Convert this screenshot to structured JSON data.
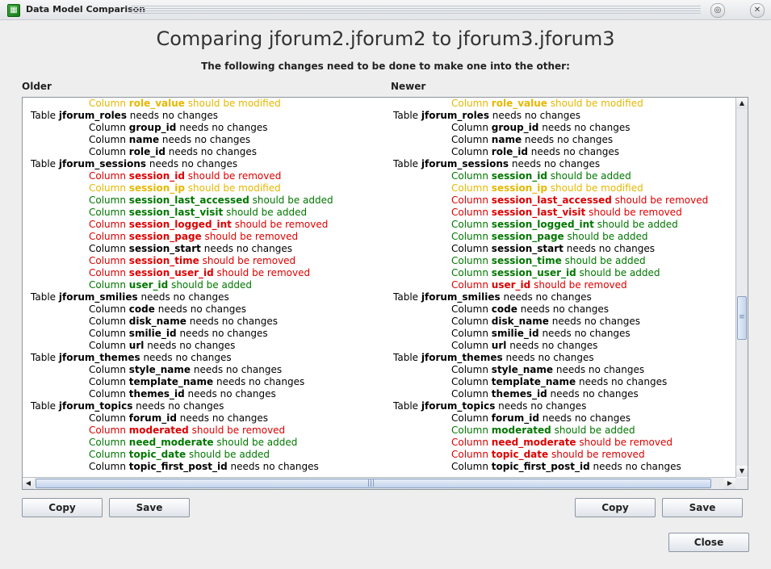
{
  "window": {
    "title": "Data Model Comparison",
    "minimize_glyph": "◎",
    "close_glyph": "✕",
    "app_icon": "table-app-icon"
  },
  "heading": "Comparing jforum2.jforum2 to jforum3.jforum3",
  "subheading": "The following changes need to be done to make one into the other:",
  "older_label": "Older",
  "newer_label": "Newer",
  "older_lines": [
    {
      "prefix": "Column",
      "name": "role_value",
      "suffix": "should be modified",
      "status": "mod",
      "indent": true
    },
    {
      "prefix": "Table",
      "name": "jforum_roles",
      "suffix": "needs no changes",
      "status": "none",
      "indent": false
    },
    {
      "prefix": "Column",
      "name": "group_id",
      "suffix": "needs no changes",
      "status": "none",
      "indent": true
    },
    {
      "prefix": "Column",
      "name": "name",
      "suffix": "needs no changes",
      "status": "none",
      "indent": true
    },
    {
      "prefix": "Column",
      "name": "role_id",
      "suffix": "needs no changes",
      "status": "none",
      "indent": true
    },
    {
      "prefix": "Table",
      "name": "jforum_sessions",
      "suffix": "needs no changes",
      "status": "none",
      "indent": false
    },
    {
      "prefix": "Column",
      "name": "session_id",
      "suffix": "should be removed",
      "status": "rem",
      "indent": true
    },
    {
      "prefix": "Column",
      "name": "session_ip",
      "suffix": "should be modified",
      "status": "mod",
      "indent": true
    },
    {
      "prefix": "Column",
      "name": "session_last_accessed",
      "suffix": "should be added",
      "status": "add",
      "indent": true
    },
    {
      "prefix": "Column",
      "name": "session_last_visit",
      "suffix": "should be added",
      "status": "add",
      "indent": true
    },
    {
      "prefix": "Column",
      "name": "session_logged_int",
      "suffix": "should be removed",
      "status": "rem",
      "indent": true
    },
    {
      "prefix": "Column",
      "name": "session_page",
      "suffix": "should be removed",
      "status": "rem",
      "indent": true
    },
    {
      "prefix": "Column",
      "name": "session_start",
      "suffix": "needs no changes",
      "status": "none",
      "indent": true
    },
    {
      "prefix": "Column",
      "name": "session_time",
      "suffix": "should be removed",
      "status": "rem",
      "indent": true
    },
    {
      "prefix": "Column",
      "name": "session_user_id",
      "suffix": "should be removed",
      "status": "rem",
      "indent": true
    },
    {
      "prefix": "Column",
      "name": "user_id",
      "suffix": "should be added",
      "status": "add",
      "indent": true
    },
    {
      "prefix": "Table",
      "name": "jforum_smilies",
      "suffix": "needs no changes",
      "status": "none",
      "indent": false
    },
    {
      "prefix": "Column",
      "name": "code",
      "suffix": "needs no changes",
      "status": "none",
      "indent": true
    },
    {
      "prefix": "Column",
      "name": "disk_name",
      "suffix": "needs no changes",
      "status": "none",
      "indent": true
    },
    {
      "prefix": "Column",
      "name": "smilie_id",
      "suffix": "needs no changes",
      "status": "none",
      "indent": true
    },
    {
      "prefix": "Column",
      "name": "url",
      "suffix": "needs no changes",
      "status": "none",
      "indent": true
    },
    {
      "prefix": "Table",
      "name": "jforum_themes",
      "suffix": "needs no changes",
      "status": "none",
      "indent": false
    },
    {
      "prefix": "Column",
      "name": "style_name",
      "suffix": "needs no changes",
      "status": "none",
      "indent": true
    },
    {
      "prefix": "Column",
      "name": "template_name",
      "suffix": "needs no changes",
      "status": "none",
      "indent": true
    },
    {
      "prefix": "Column",
      "name": "themes_id",
      "suffix": "needs no changes",
      "status": "none",
      "indent": true
    },
    {
      "prefix": "Table",
      "name": "jforum_topics",
      "suffix": "needs no changes",
      "status": "none",
      "indent": false
    },
    {
      "prefix": "Column",
      "name": "forum_id",
      "suffix": "needs no changes",
      "status": "none",
      "indent": true
    },
    {
      "prefix": "Column",
      "name": "moderated",
      "suffix": "should be removed",
      "status": "rem",
      "indent": true
    },
    {
      "prefix": "Column",
      "name": "need_moderate",
      "suffix": "should be added",
      "status": "add",
      "indent": true
    },
    {
      "prefix": "Column",
      "name": "topic_date",
      "suffix": "should be added",
      "status": "add",
      "indent": true
    },
    {
      "prefix": "Column",
      "name": "topic_first_post_id",
      "suffix": "needs no changes",
      "status": "none",
      "indent": true
    }
  ],
  "newer_lines": [
    {
      "prefix": "Column",
      "name": "role_value",
      "suffix": "should be modified",
      "status": "mod",
      "indent": true
    },
    {
      "prefix": "Table",
      "name": "jforum_roles",
      "suffix": "needs no changes",
      "status": "none",
      "indent": false
    },
    {
      "prefix": "Column",
      "name": "group_id",
      "suffix": "needs no changes",
      "status": "none",
      "indent": true
    },
    {
      "prefix": "Column",
      "name": "name",
      "suffix": "needs no changes",
      "status": "none",
      "indent": true
    },
    {
      "prefix": "Column",
      "name": "role_id",
      "suffix": "needs no changes",
      "status": "none",
      "indent": true
    },
    {
      "prefix": "Table",
      "name": "jforum_sessions",
      "suffix": "needs no changes",
      "status": "none",
      "indent": false
    },
    {
      "prefix": "Column",
      "name": "session_id",
      "suffix": "should be added",
      "status": "add",
      "indent": true
    },
    {
      "prefix": "Column",
      "name": "session_ip",
      "suffix": "should be modified",
      "status": "mod",
      "indent": true
    },
    {
      "prefix": "Column",
      "name": "session_last_accessed",
      "suffix": "should be removed",
      "status": "rem",
      "indent": true
    },
    {
      "prefix": "Column",
      "name": "session_last_visit",
      "suffix": "should be removed",
      "status": "rem",
      "indent": true
    },
    {
      "prefix": "Column",
      "name": "session_logged_int",
      "suffix": "should be added",
      "status": "add",
      "indent": true
    },
    {
      "prefix": "Column",
      "name": "session_page",
      "suffix": "should be added",
      "status": "add",
      "indent": true
    },
    {
      "prefix": "Column",
      "name": "session_start",
      "suffix": "needs no changes",
      "status": "none",
      "indent": true
    },
    {
      "prefix": "Column",
      "name": "session_time",
      "suffix": "should be added",
      "status": "add",
      "indent": true
    },
    {
      "prefix": "Column",
      "name": "session_user_id",
      "suffix": "should be added",
      "status": "add",
      "indent": true
    },
    {
      "prefix": "Column",
      "name": "user_id",
      "suffix": "should be removed",
      "status": "rem",
      "indent": true
    },
    {
      "prefix": "Table",
      "name": "jforum_smilies",
      "suffix": "needs no changes",
      "status": "none",
      "indent": false
    },
    {
      "prefix": "Column",
      "name": "code",
      "suffix": "needs no changes",
      "status": "none",
      "indent": true
    },
    {
      "prefix": "Column",
      "name": "disk_name",
      "suffix": "needs no changes",
      "status": "none",
      "indent": true
    },
    {
      "prefix": "Column",
      "name": "smilie_id",
      "suffix": "needs no changes",
      "status": "none",
      "indent": true
    },
    {
      "prefix": "Column",
      "name": "url",
      "suffix": "needs no changes",
      "status": "none",
      "indent": true
    },
    {
      "prefix": "Table",
      "name": "jforum_themes",
      "suffix": "needs no changes",
      "status": "none",
      "indent": false
    },
    {
      "prefix": "Column",
      "name": "style_name",
      "suffix": "needs no changes",
      "status": "none",
      "indent": true
    },
    {
      "prefix": "Column",
      "name": "template_name",
      "suffix": "needs no changes",
      "status": "none",
      "indent": true
    },
    {
      "prefix": "Column",
      "name": "themes_id",
      "suffix": "needs no changes",
      "status": "none",
      "indent": true
    },
    {
      "prefix": "Table",
      "name": "jforum_topics",
      "suffix": "needs no changes",
      "status": "none",
      "indent": false
    },
    {
      "prefix": "Column",
      "name": "forum_id",
      "suffix": "needs no changes",
      "status": "none",
      "indent": true
    },
    {
      "prefix": "Column",
      "name": "moderated",
      "suffix": "should be added",
      "status": "add",
      "indent": true
    },
    {
      "prefix": "Column",
      "name": "need_moderate",
      "suffix": "should be removed",
      "status": "rem",
      "indent": true
    },
    {
      "prefix": "Column",
      "name": "topic_date",
      "suffix": "should be removed",
      "status": "rem",
      "indent": true
    },
    {
      "prefix": "Column",
      "name": "topic_first_post_id",
      "suffix": "needs no changes",
      "status": "none",
      "indent": true
    }
  ],
  "status_colors": {
    "none": "#000000",
    "mod": "#e6b800",
    "rem": "#dd0000",
    "add": "#007700"
  },
  "buttons": {
    "copy_left": "Copy",
    "save_left": "Save",
    "copy_right": "Copy",
    "save_right": "Save",
    "close": "Close"
  },
  "scroll_glyphs": {
    "up": "▲",
    "down": "▼",
    "left": "◀",
    "right": "▶",
    "grip_v": "≡",
    "grip_h": "|||"
  }
}
